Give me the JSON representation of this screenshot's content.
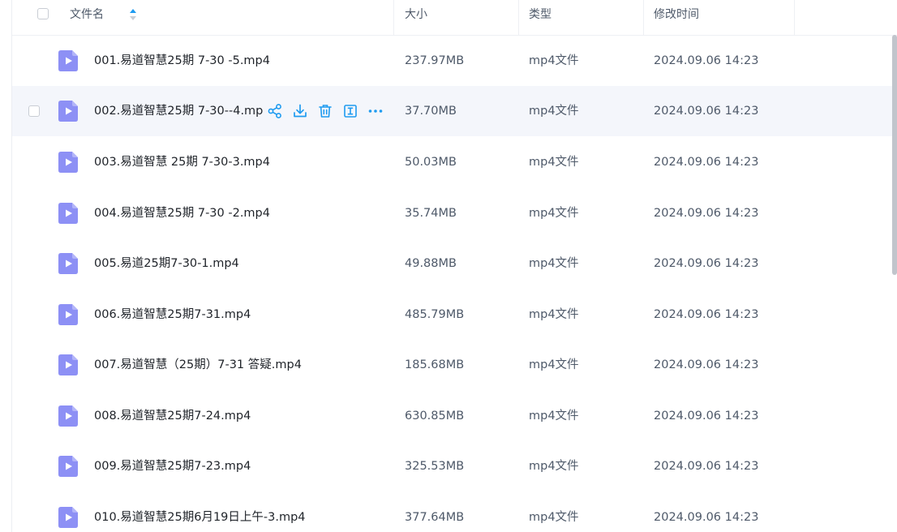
{
  "header": {
    "name_label": "文件名",
    "size_label": "大小",
    "type_label": "类型",
    "time_label": "修改时间"
  },
  "colors": {
    "accent": "#1e9bf0",
    "file_icon": "#8d90f5",
    "row_hover": "#f4f6fb"
  },
  "icons": {
    "file": "video-file-icon",
    "sort": "sort-ascending-icon",
    "actions": [
      "share-icon",
      "download-icon",
      "delete-icon",
      "rename-icon",
      "more-icon"
    ]
  },
  "files": [
    {
      "name": "001.易道智慧25期 7-30 -5.mp4",
      "size": "237.97MB",
      "type": "mp4文件",
      "modified": "2024.09.06 14:23"
    },
    {
      "name": "002.易道智慧25期 7-30--4.mp4",
      "size": "37.70MB",
      "type": "mp4文件",
      "modified": "2024.09.06 14:23"
    },
    {
      "name": "003.易道智慧 25期 7-30-3.mp4",
      "size": "50.03MB",
      "type": "mp4文件",
      "modified": "2024.09.06 14:23"
    },
    {
      "name": "004.易道智慧25期 7-30 -2.mp4",
      "size": "35.74MB",
      "type": "mp4文件",
      "modified": "2024.09.06 14:23"
    },
    {
      "name": "005.易道25期7-30-1.mp4",
      "size": "49.88MB",
      "type": "mp4文件",
      "modified": "2024.09.06 14:23"
    },
    {
      "name": "006.易道智慧25期7-31.mp4",
      "size": "485.79MB",
      "type": "mp4文件",
      "modified": "2024.09.06 14:23"
    },
    {
      "name": "007.易道智慧（25期）7-31 答疑.mp4",
      "size": "185.68MB",
      "type": "mp4文件",
      "modified": "2024.09.06 14:23"
    },
    {
      "name": "008.易道智慧25期7-24.mp4",
      "size": "630.85MB",
      "type": "mp4文件",
      "modified": "2024.09.06 14:23"
    },
    {
      "name": "009.易道智慧25期7-23.mp4",
      "size": "325.53MB",
      "type": "mp4文件",
      "modified": "2024.09.06 14:23"
    },
    {
      "name": "010.易道智慧25期6月19日上午-3.mp4",
      "size": "377.64MB",
      "type": "mp4文件",
      "modified": "2024.09.06 14:23"
    }
  ]
}
